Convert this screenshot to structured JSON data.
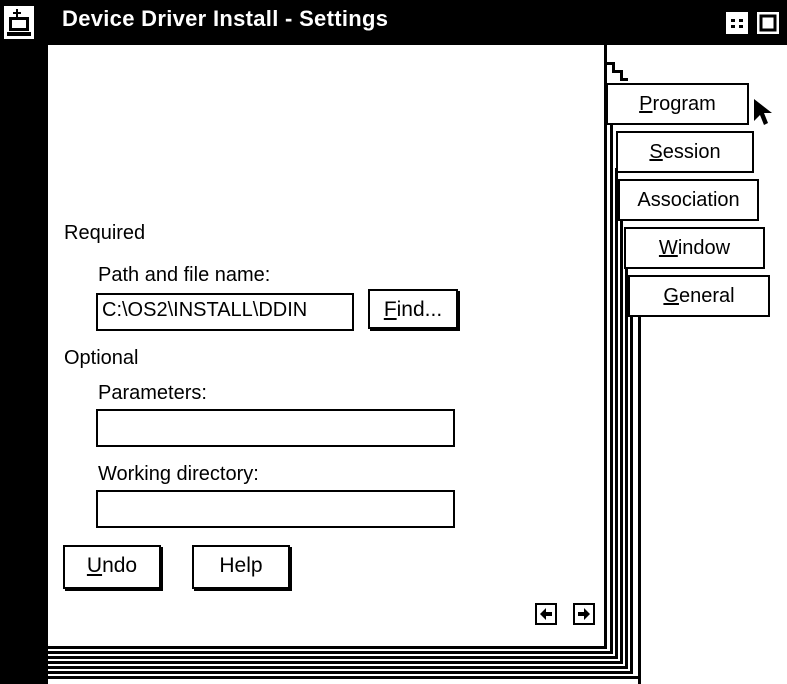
{
  "window": {
    "title": "Device Driver Install - Settings",
    "system_menu_icon": "system-menu-icon",
    "minimize_icon": "minimize-icon",
    "maximize_icon": "maximize-icon"
  },
  "tabs": [
    {
      "mnemonic": "P",
      "rest": "rogram"
    },
    {
      "mnemonic": "S",
      "rest": "ession"
    },
    {
      "label": "Association"
    },
    {
      "mnemonic": "W",
      "rest": "indow"
    },
    {
      "mnemonic": "G",
      "rest": "eneral"
    }
  ],
  "form": {
    "required_label": "Required",
    "path_label": "Path and file name:",
    "path_value": "C:\\OS2\\INSTALL\\DDIN",
    "find_button": {
      "mnemonic": "F",
      "rest": "ind..."
    },
    "optional_label": "Optional",
    "parameters_label": "Parameters:",
    "parameters_value": "",
    "working_dir_label": "Working directory:",
    "working_dir_value": ""
  },
  "buttons": {
    "undo": {
      "mnemonic": "U",
      "rest": "ndo"
    },
    "help": "Help"
  },
  "page_nav": {
    "prev_icon": "left-arrow-icon",
    "next_icon": "right-arrow-icon"
  }
}
